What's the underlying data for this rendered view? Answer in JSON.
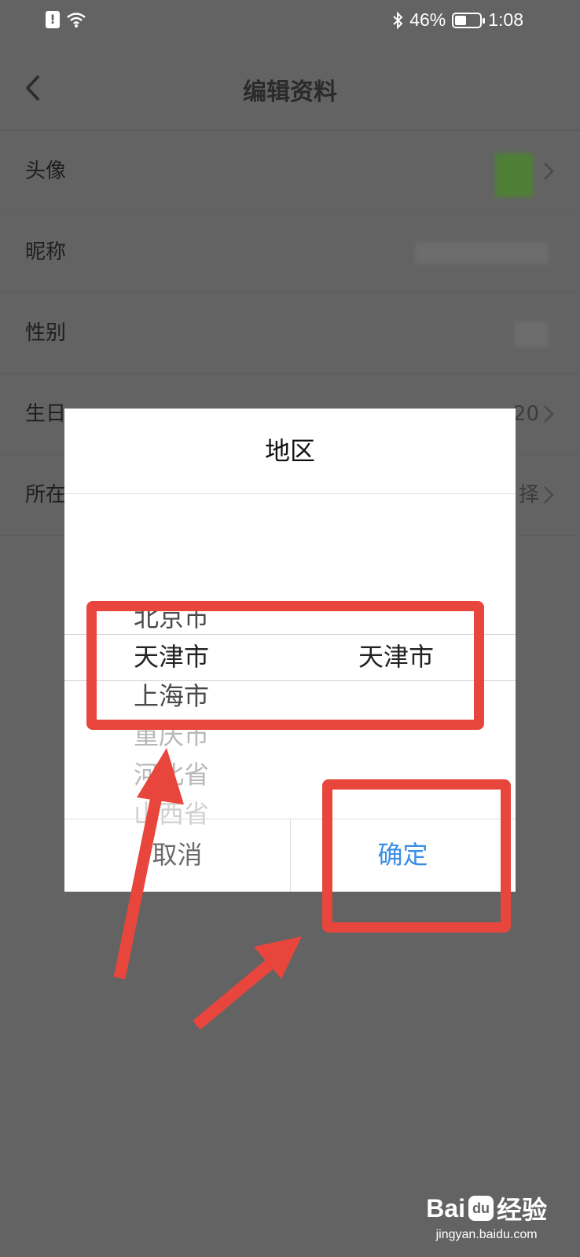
{
  "status_bar": {
    "battery_percent": "46%",
    "battery_level": 0.46,
    "time": "1:08",
    "icons": [
      "alert-icon",
      "wifi-icon",
      "bluetooth-icon",
      "battery-icon"
    ]
  },
  "header": {
    "title": "编辑资料",
    "back_icon": "chevron-left-icon"
  },
  "form": {
    "rows": [
      {
        "label": "头像",
        "value": ""
      },
      {
        "label": "昵称",
        "value": ""
      },
      {
        "label": "性别",
        "value": ""
      },
      {
        "label": "生日",
        "value": "20"
      },
      {
        "label": "所在",
        "value": "择"
      }
    ]
  },
  "dialog": {
    "title": "地区",
    "picker": {
      "province_items": [
        "北京市",
        "天津市",
        "上海市",
        "重庆市",
        "河北省",
        "山西省"
      ],
      "selected_province": "天津市",
      "selected_city": "天津市"
    },
    "cancel_label": "取消",
    "confirm_label": "确定"
  },
  "colors": {
    "overlay": "#636363",
    "confirm": "#3a8ee6",
    "annotation": "#e8463c"
  },
  "watermark": {
    "brand": "Bai",
    "brand_suffix": "经验",
    "url": "jingyan.baidu.com"
  }
}
